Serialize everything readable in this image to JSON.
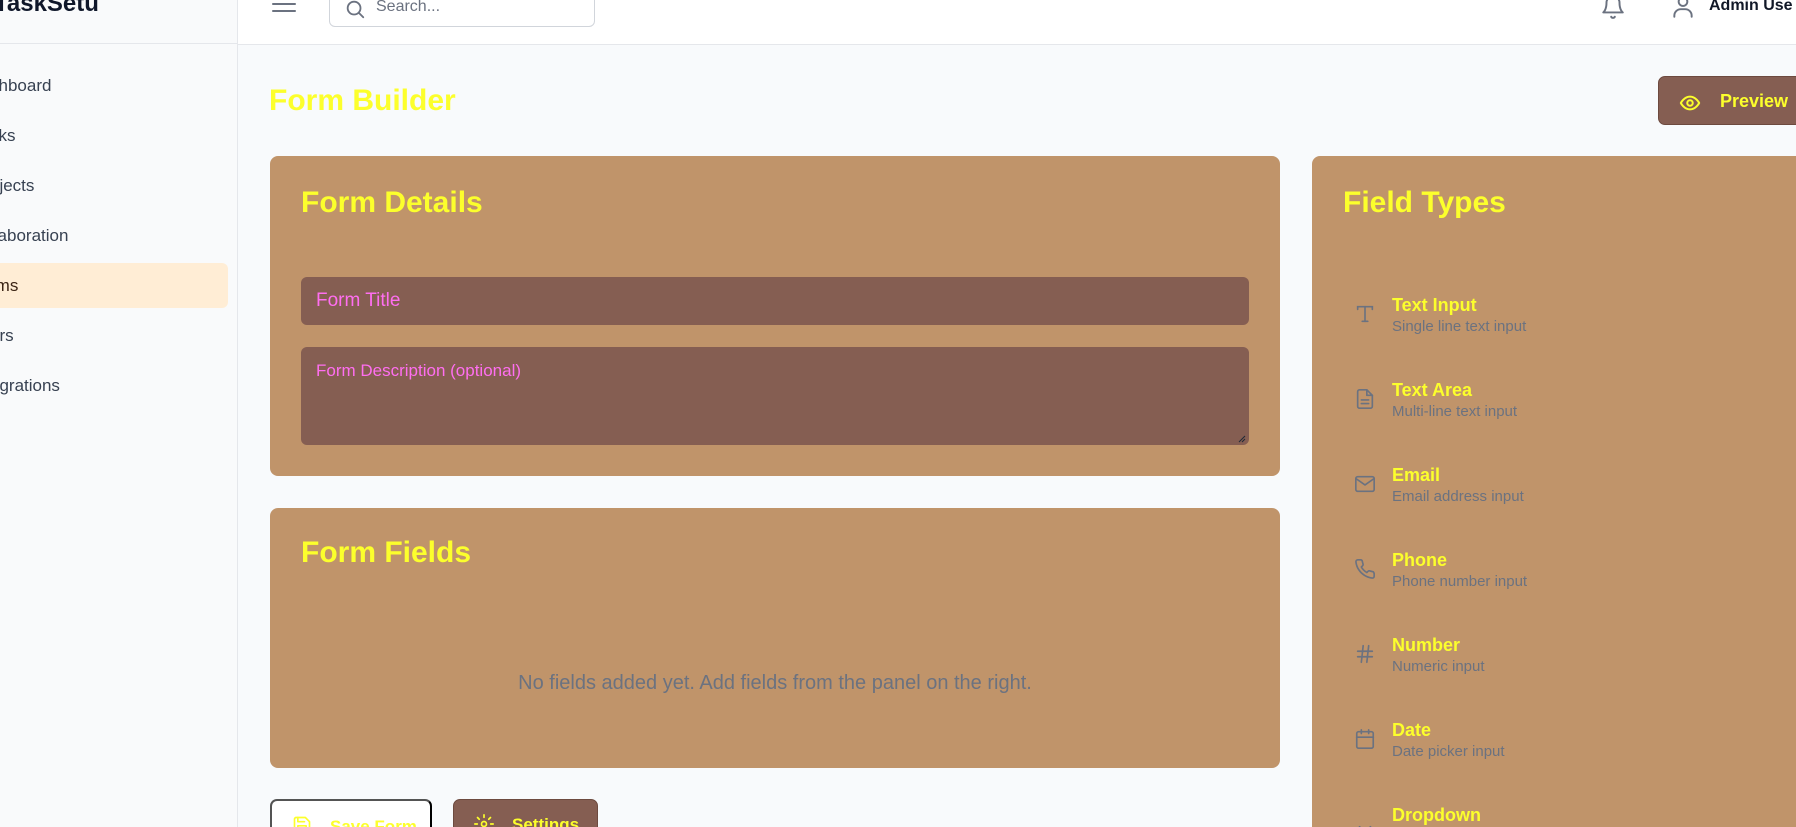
{
  "app": {
    "brand": "TaskSetu"
  },
  "sidebar": {
    "items": [
      {
        "label": "Dashboard",
        "visible": "shboard"
      },
      {
        "label": "Tasks",
        "visible": "sks"
      },
      {
        "label": "Projects",
        "visible": "ojects"
      },
      {
        "label": "Collaboration",
        "visible": "llaboration"
      },
      {
        "label": "Forms",
        "visible": "rms",
        "active": true
      },
      {
        "label": "Users",
        "visible": "ers"
      },
      {
        "label": "Integrations",
        "visible": "egrations"
      }
    ]
  },
  "header": {
    "search_placeholder": "Search...",
    "user_name": "Admin Use"
  },
  "page": {
    "title": "Form Builder",
    "preview_label": "Preview"
  },
  "form_details": {
    "heading": "Form Details",
    "title_placeholder": "Form Title",
    "description_placeholder": "Form Description (optional)"
  },
  "form_fields": {
    "heading": "Form Fields",
    "empty_message": "No fields added yet. Add fields from the panel on the right."
  },
  "field_types": {
    "heading": "Field Types",
    "items": [
      {
        "name": "Text Input",
        "description": "Single line text input",
        "icon": "type-icon"
      },
      {
        "name": "Text Area",
        "description": "Multi-line text input",
        "icon": "file-text-icon"
      },
      {
        "name": "Email",
        "description": "Email address input",
        "icon": "mail-icon"
      },
      {
        "name": "Phone",
        "description": "Phone number input",
        "icon": "phone-icon"
      },
      {
        "name": "Number",
        "description": "Numeric input",
        "icon": "hash-icon"
      },
      {
        "name": "Date",
        "description": "Date picker input",
        "icon": "calendar-icon"
      },
      {
        "name": "Dropdown",
        "description": "",
        "icon": "chevron-down-icon"
      }
    ]
  },
  "actions": {
    "save_label": "Save Form",
    "settings_label": "Settings"
  },
  "colors": {
    "accent_text": "#fcff2c",
    "card_bg": "#c0946a",
    "input_bg": "#855e52",
    "placeholder": "#ff6ef0",
    "active_nav_bg": "#ffedd5"
  }
}
